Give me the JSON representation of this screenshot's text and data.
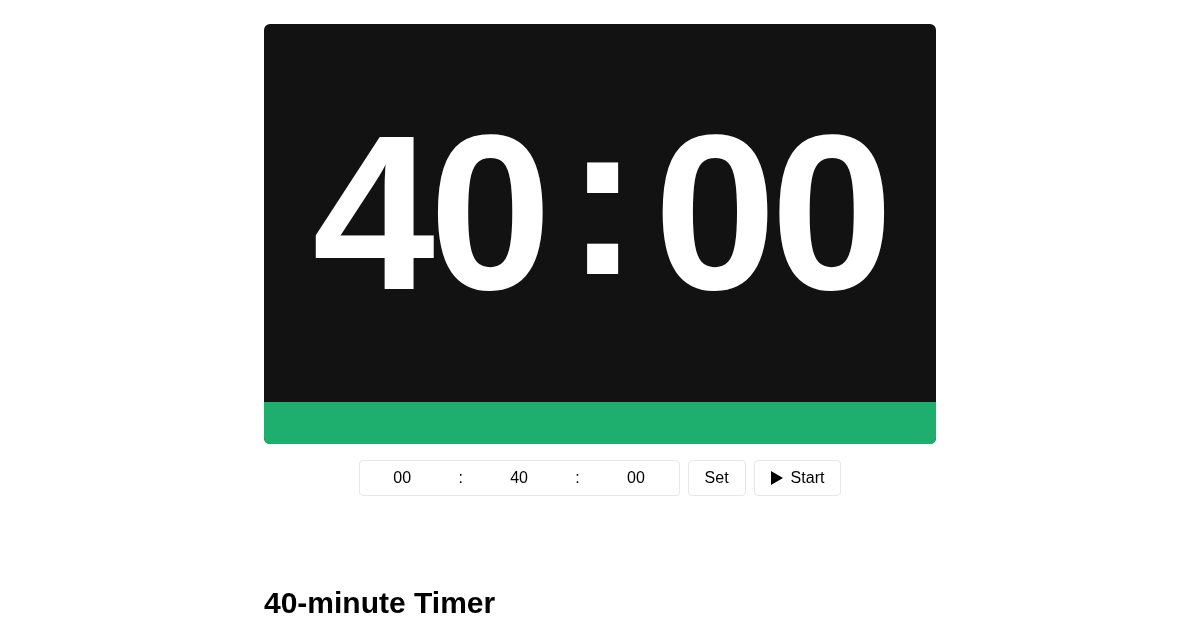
{
  "display": {
    "minutes": "40",
    "separator": ":",
    "seconds": "00"
  },
  "progress": {
    "level": 1
  },
  "time_input": {
    "hours": "00",
    "separator_1": ":",
    "minutes": "40",
    "separator_2": ":",
    "seconds": "00"
  },
  "buttons": {
    "set": "Set",
    "start": "Start"
  },
  "heading": "40-minute Timer"
}
